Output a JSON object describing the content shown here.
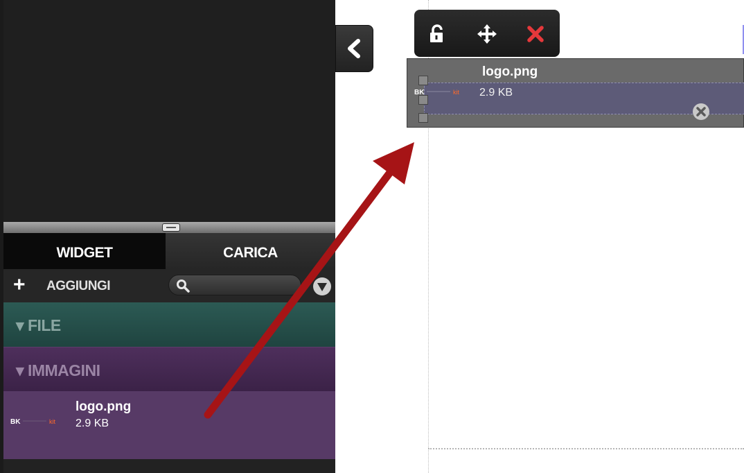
{
  "sidebar": {
    "tabs": [
      {
        "label": "WIDGET",
        "active": false
      },
      {
        "label": "CARICA",
        "active": true
      }
    ],
    "toolbar": {
      "add_icon": "+",
      "add_label": "AGGIUNGI",
      "search_value": "",
      "search_icon": "search-icon",
      "filter_icon": "filter-icon"
    },
    "sections": [
      {
        "label": "FILE",
        "color": "#2c5a54"
      },
      {
        "label": "IMMAGINI",
        "color": "#4e2f5c"
      }
    ],
    "items": [
      {
        "name": "logo.png",
        "size": "2.9 KB",
        "thumb_left": "BK",
        "thumb_right": "kit"
      }
    ]
  },
  "canvas": {
    "float_toolbar": {
      "lock_icon": "unlock-icon",
      "move_icon": "move-icon",
      "close_icon": "close-icon"
    },
    "placed_widget": {
      "name": "logo.png",
      "size": "2.9 KB",
      "thumb_left": "BK",
      "thumb_right": "kit",
      "remove_icon": "remove-icon"
    }
  },
  "colors": {
    "accent_close": "#e5383b",
    "arrow": "#a61416"
  }
}
